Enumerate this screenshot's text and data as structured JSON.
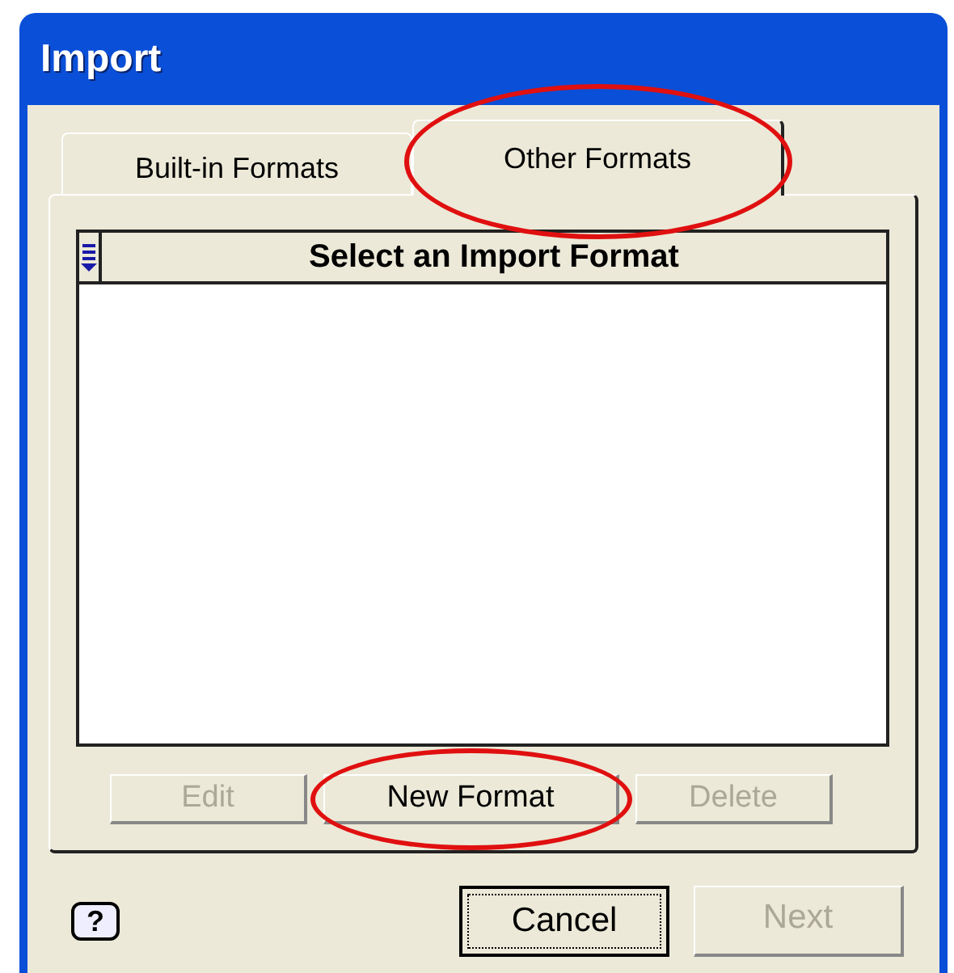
{
  "window": {
    "title": "Import"
  },
  "tabs": [
    {
      "label": "Built-in Formats",
      "selected": false,
      "highlighted": false
    },
    {
      "label": "Other Formats",
      "selected": true,
      "highlighted": true
    }
  ],
  "list": {
    "header": "Select an Import Format"
  },
  "list_buttons": [
    {
      "label": "Edit",
      "disabled": true,
      "highlighted": false
    },
    {
      "label": "New Format",
      "disabled": false,
      "highlighted": true
    },
    {
      "label": "Delete",
      "disabled": true,
      "highlighted": false
    }
  ],
  "help_button": {
    "label": "?"
  },
  "dialog_buttons": [
    {
      "label": "Cancel",
      "disabled": false,
      "focused": true
    },
    {
      "label": "Next",
      "disabled": true,
      "focused": false
    }
  ]
}
